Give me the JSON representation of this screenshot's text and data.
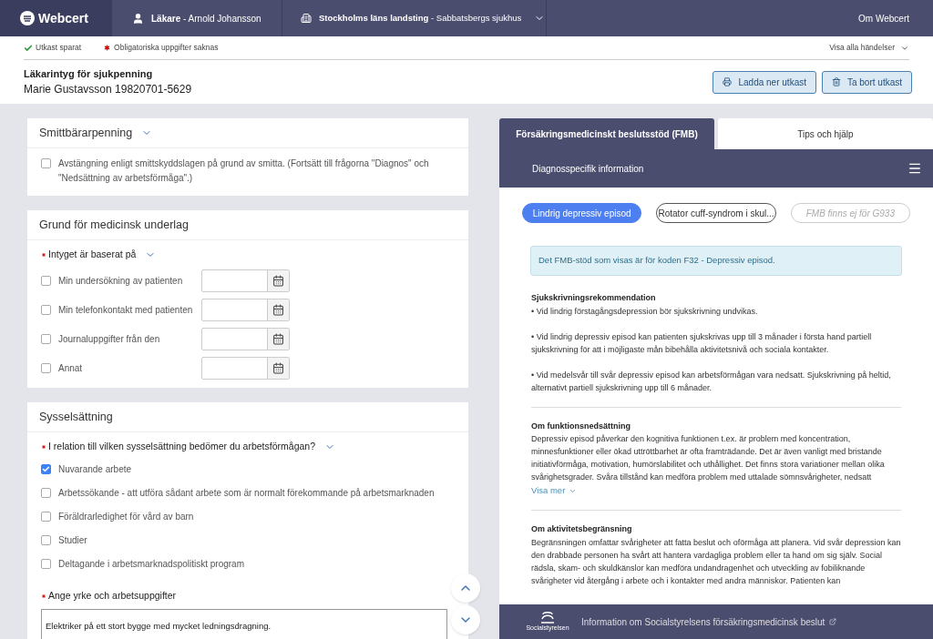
{
  "nav": {
    "logo": "Webcert",
    "role": "Läkare",
    "user": " - Arnold Johansson",
    "county": "Stockholms läns landsting",
    "unit": " - Sabbatsbergs sjukhus",
    "about": "Om Webcert"
  },
  "status": {
    "items": [
      {
        "kind": "saved",
        "text": "Utkast sparat"
      },
      {
        "kind": "required",
        "text": "Obligatoriska uppgifter saknas"
      }
    ],
    "events": "Visa alla händelser"
  },
  "header": {
    "title": "Läkarintyg för sjukpenning",
    "patient": "Marie Gustavsson 19820701-5629",
    "buttons": [
      {
        "label": "Ladda ner utkast"
      },
      {
        "label": "Ta bort utkast"
      }
    ]
  },
  "sections": [
    {
      "title": "Smittbärarpenning",
      "expandable": true,
      "questions": [
        {
          "options": [
            {
              "kind": "checkbox",
              "label": "Avstängning enligt smittskyddslagen på grund av smitta. (Fortsätt till frågorna \"Diagnos\" och \"Nedsättning av arbetsförmåga\".)",
              "checked": false
            }
          ]
        }
      ]
    },
    {
      "title": "Grund för medicinsk underlag",
      "expandable": false,
      "questions": [
        {
          "label": "Intyget är baserat på",
          "required": true,
          "expandable": true,
          "options": [
            {
              "kind": "date",
              "label": "Min undersökning av patienten",
              "checked": false
            },
            {
              "kind": "date",
              "label": "Min telefonkontakt med patienten",
              "checked": false
            },
            {
              "kind": "date",
              "label": "Journaluppgifter från den",
              "checked": false
            },
            {
              "kind": "date",
              "label": "Annat",
              "checked": false
            }
          ]
        }
      ]
    },
    {
      "title": "Sysselsättning",
      "expandable": false,
      "questions": [
        {
          "label": "I relation till vilken sysselsättning bedömer du arbetsförmågan?",
          "required": true,
          "expandable": true,
          "options": [
            {
              "kind": "checkbox",
              "label": "Nuvarande arbete",
              "checked": true
            },
            {
              "kind": "checkbox",
              "label": "Arbetssökande - att utföra sådant arbete som är normalt förekommande på arbetsmarknaden",
              "checked": false
            },
            {
              "kind": "checkbox",
              "label": "Föräldrarledighet för vård av barn",
              "checked": false
            },
            {
              "kind": "checkbox",
              "label": "Studier",
              "checked": false
            },
            {
              "kind": "checkbox",
              "label": "Deltagande i arbetsmarknadspolitiskt program",
              "checked": false
            }
          ]
        },
        {
          "label": "Ange yrke och arbetsuppgifter",
          "required": true,
          "expandable": false,
          "value": "Elektriker på ett stort bygge med mycket ledningsdragning."
        }
      ]
    }
  ],
  "panel": {
    "tabs": [
      {
        "label": "Försäkringsmedicinskt beslutsstöd (FMB)",
        "selected": true
      },
      {
        "label": "Tips och hjälp",
        "selected": false
      }
    ],
    "subheader": "Diagnosspecifik information",
    "diagnoses": [
      {
        "label": "Lindrig depressiv episod",
        "selected": true,
        "disabled": false
      },
      {
        "label": "Rotator cuff-syndrom i skul...",
        "selected": false,
        "disabled": false
      },
      {
        "label": "FMB finns ej för G933",
        "selected": false,
        "disabled": true
      }
    ],
    "info": "Det FMB-stöd som visas är för koden F32 - Depressiv episod.",
    "blocks": [
      {
        "title": "Sjukskrivningsrekommendation",
        "paragraphs": [
          "• Vid lindrig förstagångsdepression bör sjukskrivning undvikas.",
          "• Vid lindrig depressiv episod kan patienten sjukskrivas upp till 3 månader i första hand partiell sjukskrivning för att i möjligaste mån bibehålla aktivitetsnivå och sociala kontakter.",
          "• Vid medelsvår till svår depressiv episod kan arbetsförmågan vara nedsatt. Sjukskrivning på heltid, alternativt partiell sjukskrivning upp till 6 månader."
        ]
      },
      {
        "title": "Om funktionsnedsättning",
        "paragraphs": [
          "Depressiv episod påverkar den kognitiva funktionen t.ex. är problem med koncentration, minnesfunktioner eller ökad uttröttbarhet är ofta framträdande. Det är även vanligt med bristande initiativförmåga, motivation, humörslabilitet och uthållighet. Det finns stora variationer mellan olika svårighetsgrader. Svåra tillstånd kan medföra problem med uttalade sömnsvårigheter, nedsatt"
        ],
        "more": "Visa mer"
      },
      {
        "title": "Om aktivitetsbegränsning",
        "paragraphs": [
          "Begränsningen omfattar svårigheter att fatta beslut och oförmåga att planera. Vid svår depression kan den drabbade personen ha svårt att hantera vardagliga problem eller ta hand om sig själv. Social rädsla, skam- och skuldkänslor kan medföra undandragenhet och utveckling av fobiliknande svårigheter vid återgång i arbete och i kontakter med andra människor. Patienten kan"
        ]
      }
    ],
    "footer": {
      "logo": "Socialstyrelsen",
      "link": "Information om Socialstyrelsens försäkringsmedicinsk beslut"
    }
  }
}
